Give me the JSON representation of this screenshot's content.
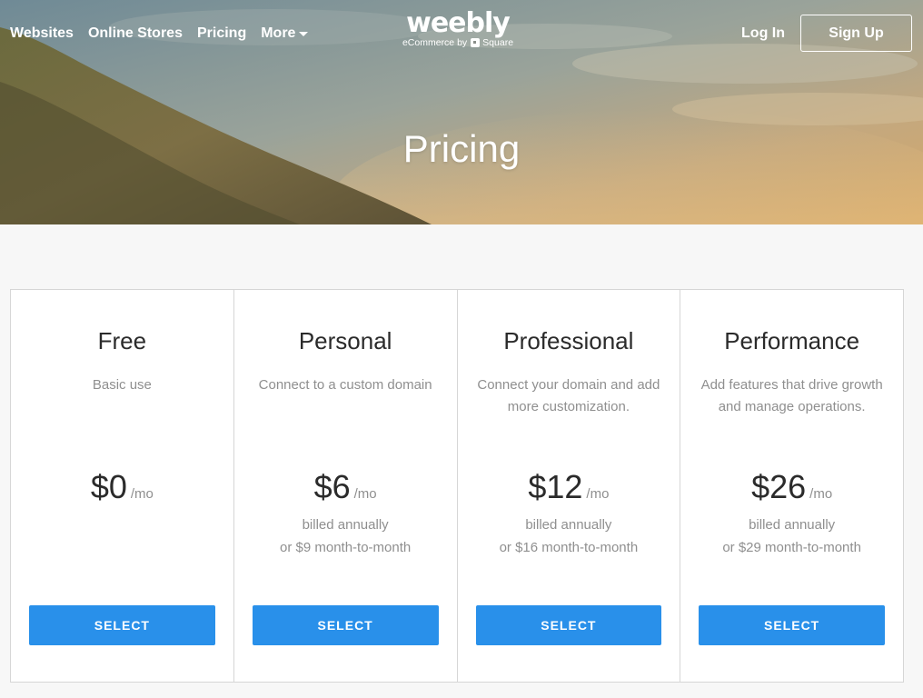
{
  "nav": {
    "links": [
      "Websites",
      "Online Stores",
      "Pricing"
    ],
    "more_label": "More",
    "logo": "weebly",
    "logo_sub_prefix": "eCommerce by",
    "logo_sub_brand": "Square",
    "login_label": "Log In",
    "signup_label": "Sign Up"
  },
  "hero": {
    "title": "Pricing"
  },
  "plans": [
    {
      "name": "Free",
      "description": "Basic use",
      "price": "$0",
      "unit": "/mo",
      "billing_line1": "",
      "billing_line2": "",
      "button": "SELECT"
    },
    {
      "name": "Personal",
      "description": "Connect to a custom domain",
      "price": "$6",
      "unit": "/mo",
      "billing_line1": "billed annually",
      "billing_line2": "or $9 month-to-month",
      "button": "SELECT"
    },
    {
      "name": "Professional",
      "description": "Connect your domain and add more customization.",
      "price": "$12",
      "unit": "/mo",
      "billing_line1": "billed annually",
      "billing_line2": "or $16 month-to-month",
      "button": "SELECT"
    },
    {
      "name": "Performance",
      "description": "Add features that drive growth and manage operations.",
      "price": "$26",
      "unit": "/mo",
      "billing_line1": "billed annually",
      "billing_line2": "or $29 month-to-month",
      "button": "SELECT"
    }
  ],
  "colors": {
    "accent": "#2990ea",
    "page_bg": "#f7f7f7",
    "muted_text": "#8f8f8f"
  }
}
